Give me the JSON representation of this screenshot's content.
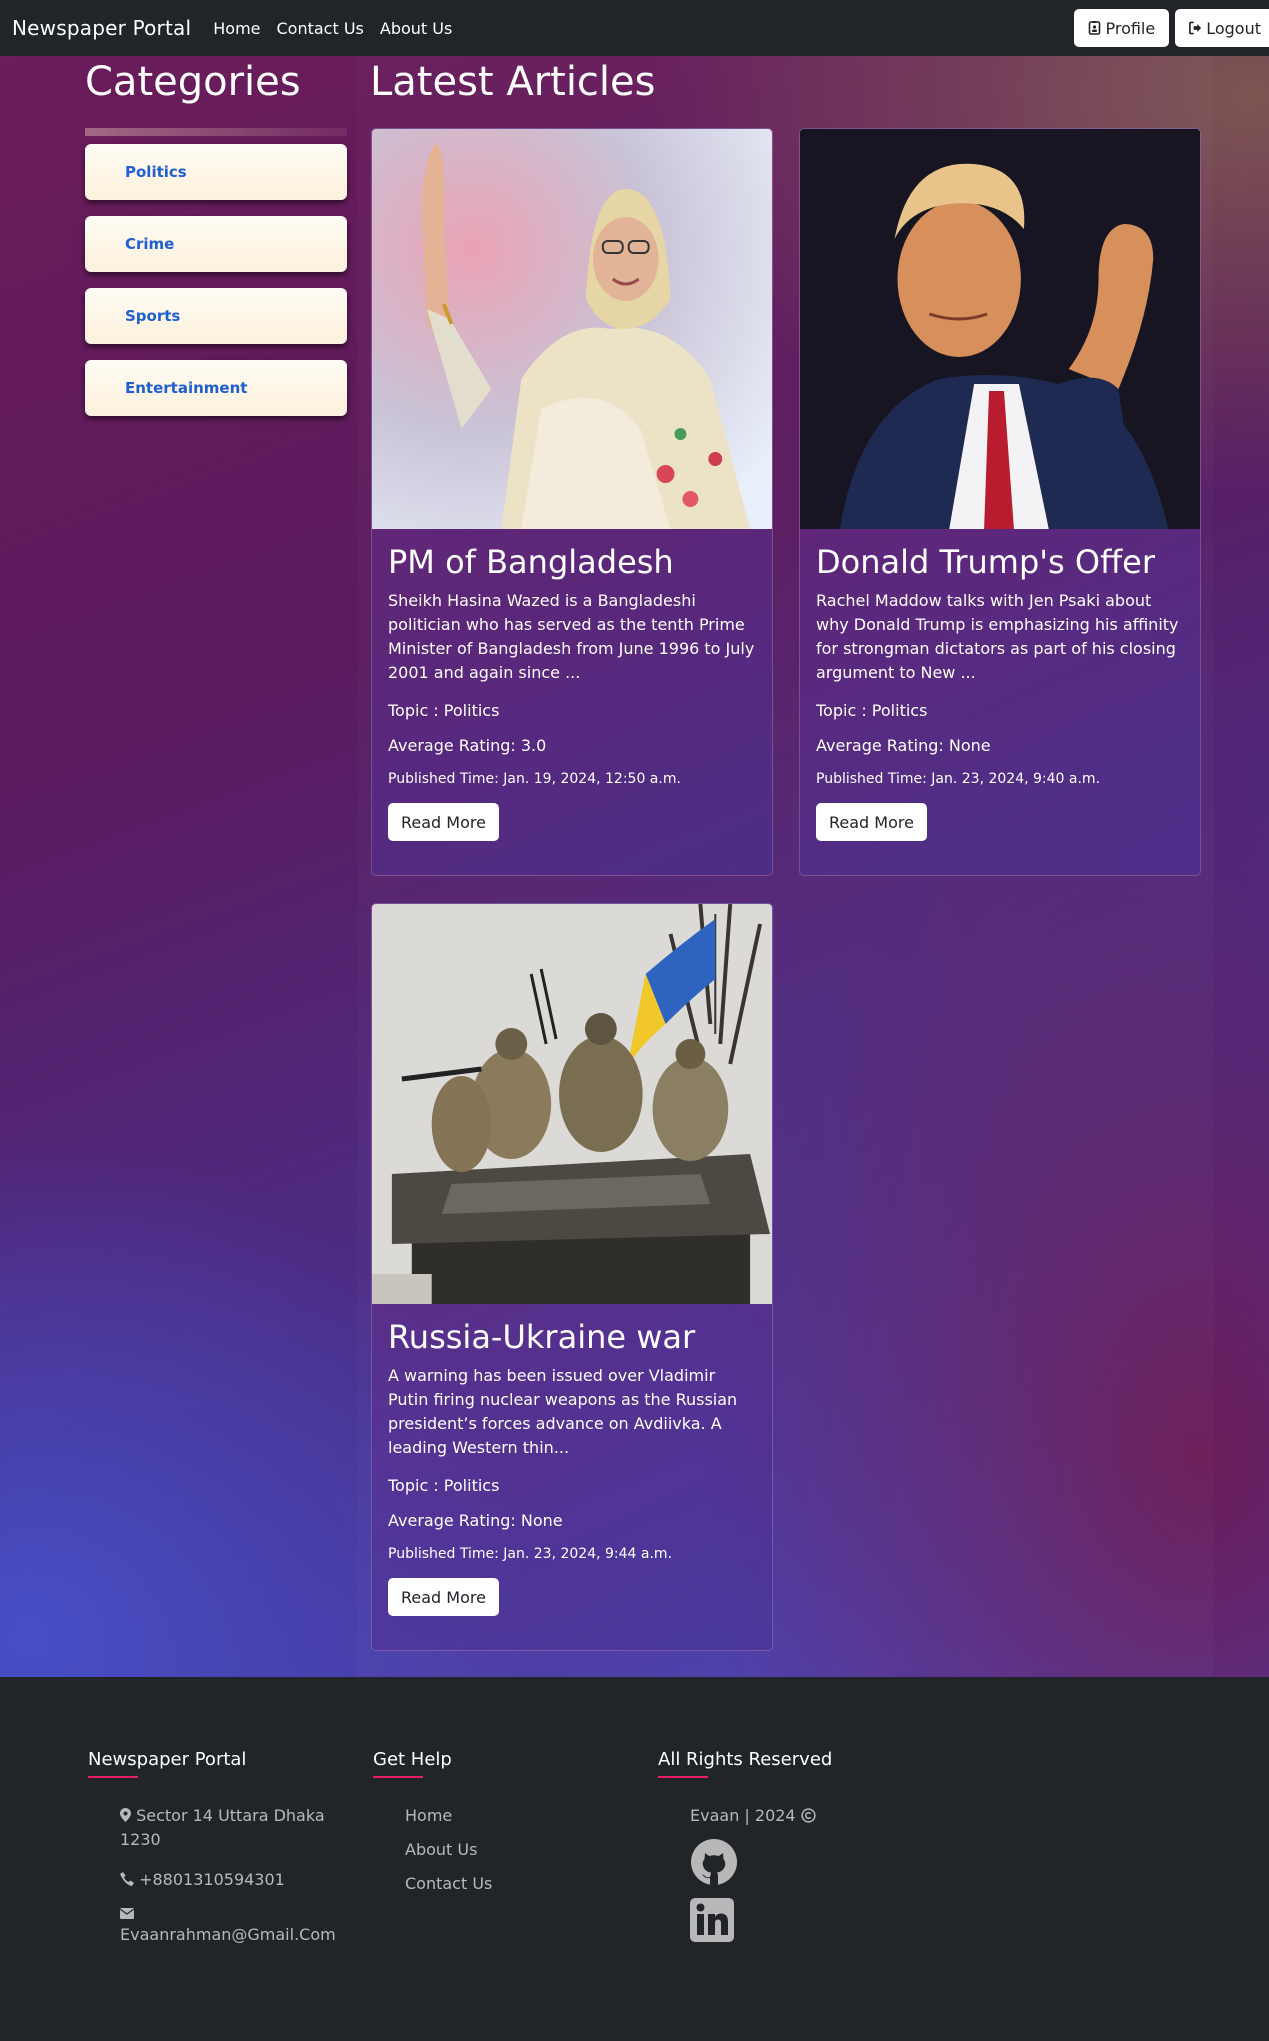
{
  "nav": {
    "brand": "Newspaper Portal",
    "links": [
      "Home",
      "Contact Us",
      "About Us"
    ],
    "profile_label": "Profile",
    "logout_label": "Logout"
  },
  "sidebar": {
    "title": "Categories",
    "categories": [
      "Politics",
      "Crime",
      "Sports",
      "Entertainment"
    ]
  },
  "main": {
    "title": "Latest Articles",
    "articles": [
      {
        "title": "PM of Bangladesh",
        "summary": "Sheikh Hasina Wazed is a Bangladeshi politician who has served as the tenth Prime Minister of Bangladesh from June 1996 to July 2001 and again since ...",
        "topic": "Topic : Politics",
        "rating": "Average Rating: 3.0",
        "published": "Published Time: Jan. 19, 2024, 12:50 a.m.",
        "button": "Read More"
      },
      {
        "title": "Donald Trump's Offer",
        "summary": "Rachel Maddow talks with Jen Psaki about why Donald Trump is emphasizing his affinity for strongman dictators as part of his closing argument to New ...",
        "topic": "Topic : Politics",
        "rating": "Average Rating: None",
        "published": "Published Time: Jan. 23, 2024, 9:40 a.m.",
        "button": "Read More"
      },
      {
        "title": "Russia-Ukraine war",
        "summary": "A warning has been issued over Vladimir Putin firing nuclear weapons as the Russian president’s forces advance on Avdiivka. A leading Western thin...",
        "topic": "Topic : Politics",
        "rating": "Average Rating: None",
        "published": "Published Time: Jan. 23, 2024, 9:44 a.m.",
        "button": "Read More"
      }
    ]
  },
  "footer": {
    "col1": {
      "heading": "Newspaper Portal",
      "address": "Sector 14 Uttara Dhaka 1230",
      "phone": "+8801310594301",
      "email": "Evaanrahman@Gmail.Com"
    },
    "col2": {
      "heading": "Get Help",
      "links": [
        "Home",
        "About Us",
        "Contact Us"
      ]
    },
    "col3": {
      "heading": "All Rights Reserved",
      "copyright": "Evaan | 2024"
    }
  },
  "colors": {
    "navbar": "#212529",
    "accent_underline": "#e91e63",
    "category_text": "#1f5fd1",
    "footer_text": "#b8b8b8"
  },
  "icons": [
    "id-badge-icon",
    "sign-out-icon",
    "map-marker-icon",
    "phone-icon",
    "envelope-icon",
    "copyright-icon",
    "github-icon",
    "linkedin-icon"
  ]
}
